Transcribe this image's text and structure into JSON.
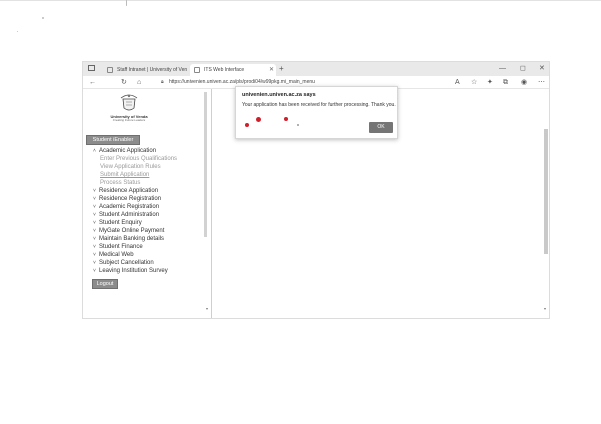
{
  "browser": {
    "tabs": [
      {
        "label": "Staff Intranet | University of Ven",
        "active": false
      },
      {
        "label": "ITS Web Interface",
        "active": true
      }
    ],
    "new_tab": "+",
    "address": "https://univenien.univen.ac.za/pls/prodi04/w99pkg.mi_main_menu",
    "window_controls": [
      "—",
      "◻",
      "✕"
    ],
    "nav_icons": [
      "arrow-left-icon",
      "refresh-icon",
      "home-icon"
    ]
  },
  "sidebar": {
    "university_name": "University of Venda",
    "motto": "Creating Future Leaders",
    "student_enabler_label": "Student iEnabler",
    "menu": [
      {
        "label": "Academic Application",
        "expanded": true
      },
      {
        "label": "Residence Application",
        "expanded": false
      },
      {
        "label": "Residence Registration",
        "expanded": false
      },
      {
        "label": "Academic Registration",
        "expanded": false
      },
      {
        "label": "Student Administration",
        "expanded": false
      },
      {
        "label": "Student Enquiry",
        "expanded": false
      },
      {
        "label": "MyGate Online Payment",
        "expanded": false
      },
      {
        "label": "Maintain Banking details",
        "expanded": false
      },
      {
        "label": "Student Finance",
        "expanded": false
      },
      {
        "label": "Medical Web",
        "expanded": false
      },
      {
        "label": "Subject Cancellation",
        "expanded": false
      },
      {
        "label": "Leaving Institution Survey",
        "expanded": false
      }
    ],
    "submenu": [
      {
        "label": "Enter Previous Qualifications"
      },
      {
        "label": "View Application Rules"
      },
      {
        "label": "Submit Application"
      },
      {
        "label": "Process Status"
      }
    ],
    "logout_label": "Logout"
  },
  "dialog": {
    "title": "univenien.univen.ac.za says",
    "message": "Your application has been received for further processing. Thank you.",
    "ok_label": "OK"
  },
  "colors": {
    "button_gray": "#8c8c8c",
    "dialog_ok": "#757575",
    "red_mark": "#d01f2a"
  }
}
